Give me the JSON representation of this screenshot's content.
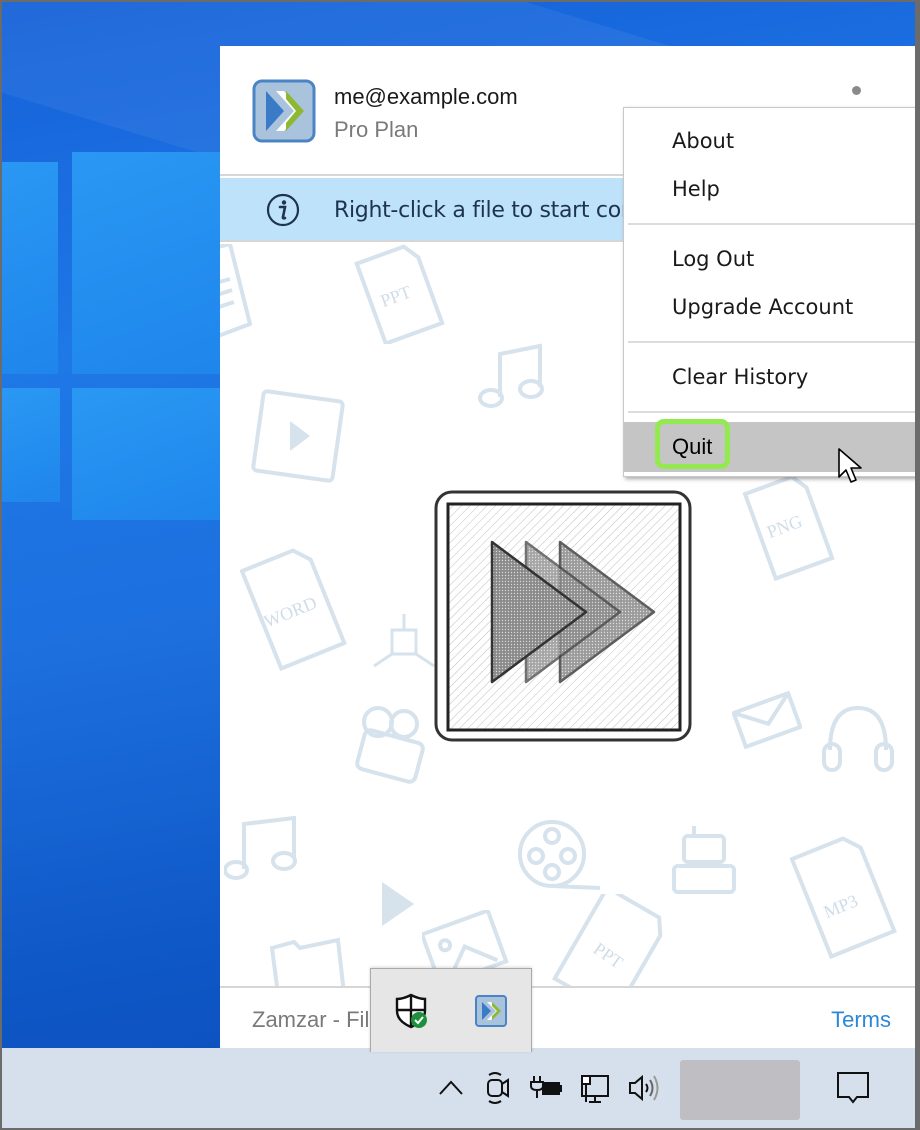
{
  "app": {
    "user_email": "me@example.com",
    "plan": "Pro Plan",
    "info_message": "Right-click a file to start converting",
    "footer_title": "Zamzar - File Converter",
    "footer_terms": "Terms",
    "colors": {
      "info_bar": "#bfe2fb",
      "link": "#2b88d8",
      "logo_blue": "#3a7bc8",
      "logo_green": "#8cb832",
      "highlight_ring": "#93ea50"
    }
  },
  "context_menu": {
    "groups": [
      [
        {
          "label": "About"
        },
        {
          "label": "Help"
        }
      ],
      [
        {
          "label": "Log Out"
        },
        {
          "label": "Upgrade Account"
        }
      ],
      [
        {
          "label": "Clear History"
        }
      ],
      [
        {
          "label": "Quit",
          "highlighted": true
        }
      ]
    ]
  },
  "background_doodles": [
    "PPT",
    "PNG",
    "WORD",
    "MP3",
    "PPT"
  ],
  "tray_popup": {
    "icons": [
      "windows-security-icon",
      "zamzar-tray-icon"
    ]
  },
  "taskbar": {
    "icons": [
      "show-hidden-icons-chevron",
      "camera-in-use-icon",
      "power-battery-icon",
      "network-icon",
      "volume-icon",
      "action-center-icon"
    ]
  }
}
